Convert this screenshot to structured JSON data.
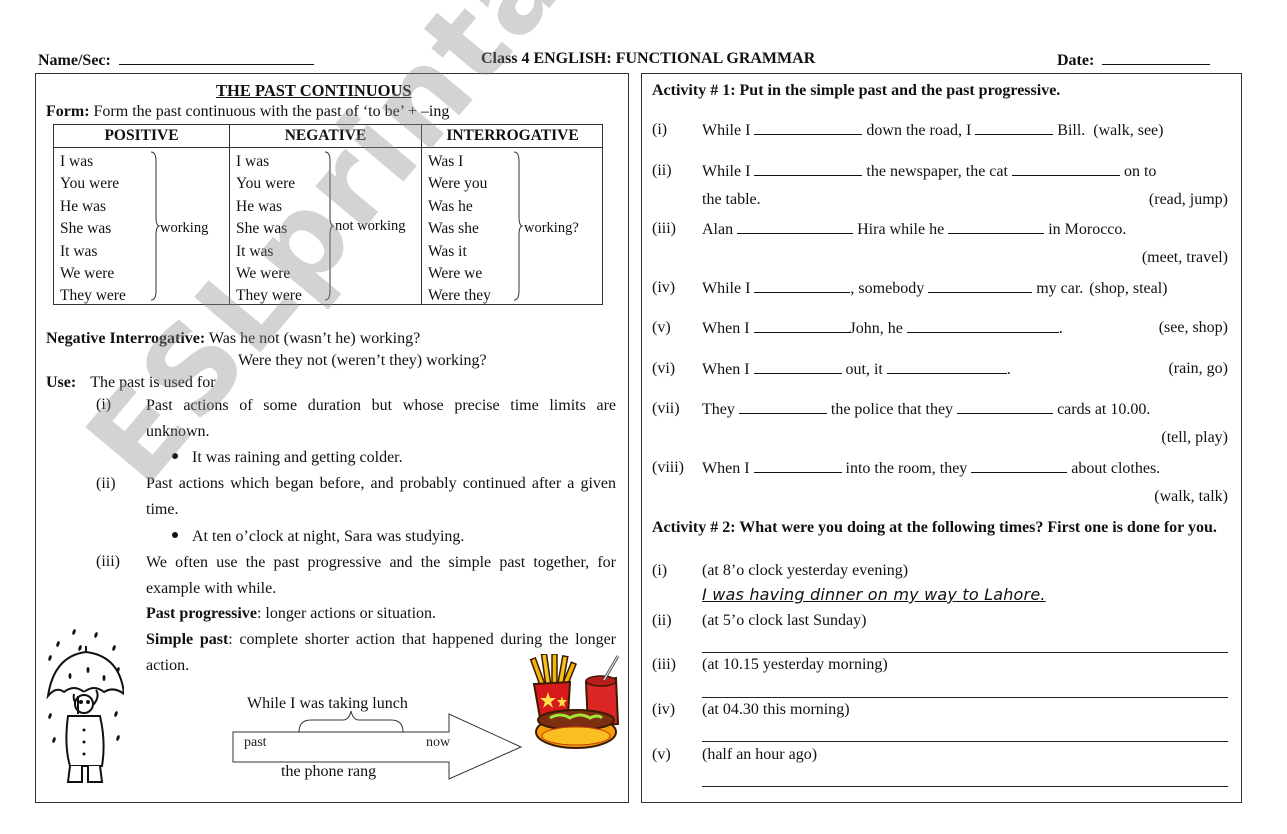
{
  "header": {
    "name_label": "Name/Sec:",
    "class_title": "Class 4 ENGLISH: FUNCTIONAL GRAMMAR",
    "date_label": "Date:"
  },
  "left": {
    "title": "THE PAST CONTINUOUS",
    "form_label": "Form:",
    "form_text": " Form the past continuous with the past of  ‘to be’ +  –ing",
    "table": {
      "headers": [
        "POSITIVE",
        "NEGATIVE",
        "INTERROGATIVE"
      ],
      "positive": [
        "I was",
        "You were",
        "He was",
        "She was",
        "It was",
        "We were",
        "They were"
      ],
      "positive_suffix": "working",
      "negative": [
        "I was",
        "You were",
        "He was",
        "She was",
        "It was",
        "We were",
        "They were"
      ],
      "negative_suffix": "not working",
      "interrogative": [
        "Was I",
        "Were you",
        "Was he",
        "Was she",
        "Was it",
        "Were we",
        "Were they"
      ],
      "interrogative_suffix": "working?"
    },
    "neg_int_label": "Negative Interrogative:",
    "neg_int_1": " Was he not (wasn’t he) working?",
    "neg_int_2": "Were they not (weren’t they) working?",
    "use_label": "Use:",
    "use_text": "The past is used for",
    "uses": [
      {
        "num": "(i)",
        "text": "Past actions of some duration but whose precise time limits are unknown.",
        "example": "It was raining and getting colder."
      },
      {
        "num": "(ii)",
        "text": "Past actions which began before, and probably continued after a given time.",
        "example": "At  ten o’clock at night, Sara was studying."
      },
      {
        "num": "(iii)",
        "text": "We often use the past progressive and the simple past together, for example with while."
      }
    ],
    "past_prog_label": "Past progressive",
    "past_prog_text": ": longer actions or situation.",
    "simple_past_label": "Simple past",
    "simple_past_text": ": complete shorter action that happened during the longer action.",
    "timeline": {
      "top_label": "While I was taking lunch",
      "past": "past",
      "now": "now",
      "bottom_label": "the phone rang"
    }
  },
  "right": {
    "activity1_title": "Activity # 1: Put in the simple past and the past progressive.",
    "activity1": [
      {
        "num": "(i)",
        "parts": [
          "While I",
          "down the road, I",
          "Bill."
        ],
        "hint": "(walk, see)"
      },
      {
        "num": "(ii)",
        "parts": [
          "While I",
          "the newspaper, the cat",
          "on to"
        ],
        "cont": "the table.",
        "hint": "(read, jump)"
      },
      {
        "num": "(iii)",
        "parts": [
          "Alan",
          "Hira while he",
          "in Morocco."
        ],
        "hint": "(meet, travel)"
      },
      {
        "num": "(iv)",
        "parts": [
          "While I",
          ", somebody",
          "my car."
        ],
        "hint": "(shop, steal)"
      },
      {
        "num": "(v)",
        "parts": [
          "When I",
          "John, he",
          "."
        ],
        "hint": "(see, shop)"
      },
      {
        "num": "(vi)",
        "parts": [
          "When I",
          "out, it",
          "."
        ],
        "hint": "(rain, go)"
      },
      {
        "num": "(vii)",
        "parts": [
          "They",
          "the police that they",
          "cards at 10.00."
        ],
        "hint": "(tell, play)"
      },
      {
        "num": "(viii)",
        "parts": [
          "When I",
          "into the room, they",
          "about clothes."
        ],
        "hint": "(walk, talk)"
      }
    ],
    "activity2_title": "Activity # 2: What were you doing at the following times? First one is done for you.",
    "activity2": [
      {
        "num": "(i)",
        "prompt": "(at 8’o clock yesterday evening)",
        "answer": "I was having dinner on my way to Lahore."
      },
      {
        "num": "(ii)",
        "prompt": "(at 5’o clock last Sunday)"
      },
      {
        "num": "(iii)",
        "prompt": "(at 10.15 yesterday morning)"
      },
      {
        "num": "(iv)",
        "prompt": "(at 04.30 this morning)"
      },
      {
        "num": "(v)",
        "prompt": "(half an hour ago)"
      }
    ]
  },
  "watermark": "ESLprintables.com"
}
